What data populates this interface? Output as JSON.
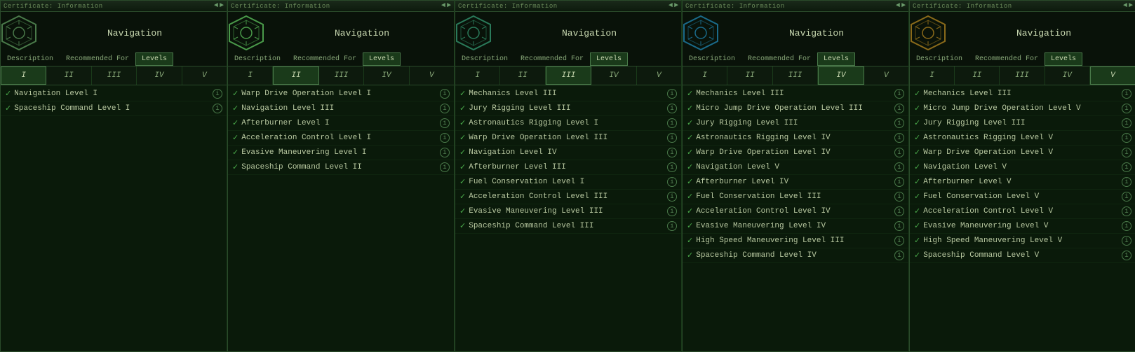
{
  "panels": [
    {
      "id": "panel-1",
      "header": "Certificate:  Information",
      "title": "Navigation",
      "active_tab": "Levels",
      "tabs": [
        "Description",
        "Recommended For",
        "Levels"
      ],
      "active_level": 0,
      "levels": [
        "I",
        "II",
        "III",
        "IV",
        "V"
      ],
      "skills": [
        {
          "name": "Navigation Level I",
          "checked": true
        },
        {
          "name": "Spaceship Command Level I",
          "checked": true
        }
      ]
    },
    {
      "id": "panel-2",
      "header": "Certificate:  Information",
      "title": "Navigation",
      "active_tab": "Levels",
      "tabs": [
        "Description",
        "Recommended For",
        "Levels"
      ],
      "active_level": 1,
      "levels": [
        "I",
        "II",
        "III",
        "IV",
        "V"
      ],
      "skills": [
        {
          "name": "Warp Drive Operation Level I",
          "checked": true
        },
        {
          "name": "Navigation Level III",
          "checked": true
        },
        {
          "name": "Afterburner Level I",
          "checked": true
        },
        {
          "name": "Acceleration Control Level I",
          "checked": true
        },
        {
          "name": "Evasive Maneuvering Level I",
          "checked": true
        },
        {
          "name": "Spaceship Command Level II",
          "checked": true
        }
      ]
    },
    {
      "id": "panel-3",
      "header": "Certificate:  Information",
      "title": "Navigation",
      "active_tab": "Levels",
      "tabs": [
        "Description",
        "Recommended For",
        "Levels"
      ],
      "active_level": 2,
      "levels": [
        "I",
        "II",
        "III",
        "IV",
        "V"
      ],
      "skills": [
        {
          "name": "Mechanics Level III",
          "checked": true
        },
        {
          "name": "Jury Rigging Level III",
          "checked": true
        },
        {
          "name": "Astronautics Rigging Level I",
          "checked": true
        },
        {
          "name": "Warp Drive Operation Level III",
          "checked": true
        },
        {
          "name": "Navigation Level IV",
          "checked": true
        },
        {
          "name": "Afterburner Level III",
          "checked": true
        },
        {
          "name": "Fuel Conservation Level I",
          "checked": true
        },
        {
          "name": "Acceleration Control Level III",
          "checked": true
        },
        {
          "name": "Evasive Maneuvering Level III",
          "checked": true
        },
        {
          "name": "Spaceship Command Level III",
          "checked": true
        }
      ]
    },
    {
      "id": "panel-4",
      "header": "Certificate:  Information",
      "title": "Navigation",
      "active_tab": "Levels",
      "tabs": [
        "Description",
        "Recommended For",
        "Levels"
      ],
      "active_level": 3,
      "levels": [
        "I",
        "II",
        "III",
        "IV",
        "V"
      ],
      "skills": [
        {
          "name": "Mechanics Level III",
          "checked": true
        },
        {
          "name": "Micro Jump Drive Operation Level III",
          "checked": true
        },
        {
          "name": "Jury Rigging Level III",
          "checked": true
        },
        {
          "name": "Astronautics Rigging Level IV",
          "checked": true
        },
        {
          "name": "Warp Drive Operation Level IV",
          "checked": true
        },
        {
          "name": "Navigation Level V",
          "checked": true
        },
        {
          "name": "Afterburner Level IV",
          "checked": true
        },
        {
          "name": "Fuel Conservation Level III",
          "checked": true
        },
        {
          "name": "Acceleration Control Level IV",
          "checked": true
        },
        {
          "name": "Evasive Maneuvering Level IV",
          "checked": true
        },
        {
          "name": "High Speed Maneuvering Level III",
          "checked": true
        },
        {
          "name": "Spaceship Command Level IV",
          "checked": true
        }
      ]
    },
    {
      "id": "panel-5",
      "header": "Certificate:  Information",
      "title": "Navigation",
      "active_tab": "Levels",
      "tabs": [
        "Description",
        "Recommended For",
        "Levels"
      ],
      "active_level": 4,
      "levels": [
        "I",
        "II",
        "III",
        "IV",
        "V"
      ],
      "skills": [
        {
          "name": "Mechanics Level III",
          "checked": true
        },
        {
          "name": "Micro Jump Drive Operation Level V",
          "checked": true
        },
        {
          "name": "Jury Rigging Level III",
          "checked": true
        },
        {
          "name": "Astronautics Rigging Level V",
          "checked": true
        },
        {
          "name": "Warp Drive Operation Level V",
          "checked": true
        },
        {
          "name": "Navigation Level V",
          "checked": true
        },
        {
          "name": "Afterburner Level V",
          "checked": true
        },
        {
          "name": "Fuel Conservation Level V",
          "checked": true
        },
        {
          "name": "Acceleration Control Level V",
          "checked": true
        },
        {
          "name": "Evasive Maneuvering Level V",
          "checked": true
        },
        {
          "name": "High Speed Maneuvering Level V",
          "checked": true
        },
        {
          "name": "Spaceship Command Level V",
          "checked": true
        }
      ]
    }
  ],
  "icons": {
    "info": "i",
    "check": "✓",
    "nav_prev": "◄",
    "nav_next": "►"
  }
}
